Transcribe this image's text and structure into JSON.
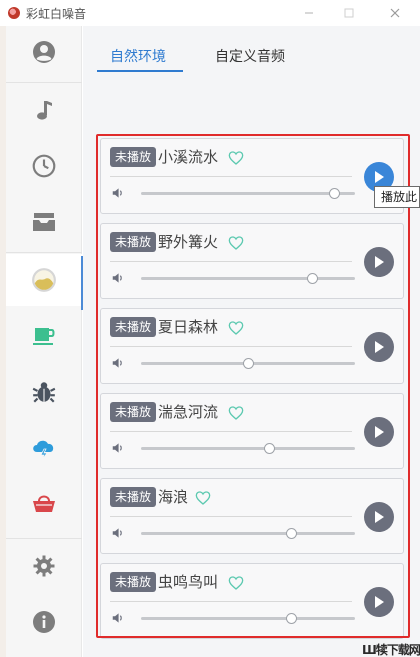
{
  "window": {
    "title": "彩虹白噪音"
  },
  "sidebar": {
    "items": [
      {
        "icon": "user-icon"
      },
      {
        "icon": "music-note-icon"
      },
      {
        "icon": "clock-icon"
      },
      {
        "icon": "inbox-icon"
      },
      {
        "icon": "landscape-icon",
        "active": true
      },
      {
        "icon": "coffee-cup-icon"
      },
      {
        "icon": "bug-icon"
      },
      {
        "icon": "cloud-storm-icon"
      },
      {
        "icon": "basket-icon"
      },
      {
        "icon": "gear-icon"
      },
      {
        "icon": "info-icon"
      }
    ]
  },
  "tabs": [
    {
      "label": "自然环境",
      "active": true
    },
    {
      "label": "自定义音频",
      "active": false
    }
  ],
  "cards": [
    {
      "status": "未播放",
      "title": "小溪流水",
      "volume": 0.9,
      "active": true
    },
    {
      "status": "未播放",
      "title": "野外篝火",
      "volume": 0.8,
      "active": false
    },
    {
      "status": "未播放",
      "title": "夏日森林",
      "volume": 0.5,
      "active": false
    },
    {
      "status": "未播放",
      "title": "湍急河流",
      "volume": 0.6,
      "active": false
    },
    {
      "status": "未播放",
      "title": "海浪",
      "volume": 0.7,
      "active": false
    },
    {
      "status": "未播放",
      "title": "虫鸣鸟叫",
      "volume": 0.7,
      "active": false
    }
  ],
  "tooltip": {
    "text": "播放此"
  },
  "watermark": {
    "text": "Ш犊下载网"
  },
  "colors": {
    "accent": "#2f7bd0",
    "play_active": "#3a86d8",
    "play_default": "#6b6f7d",
    "highlight": "#e02b2b",
    "heart": "#5cc9b0"
  }
}
